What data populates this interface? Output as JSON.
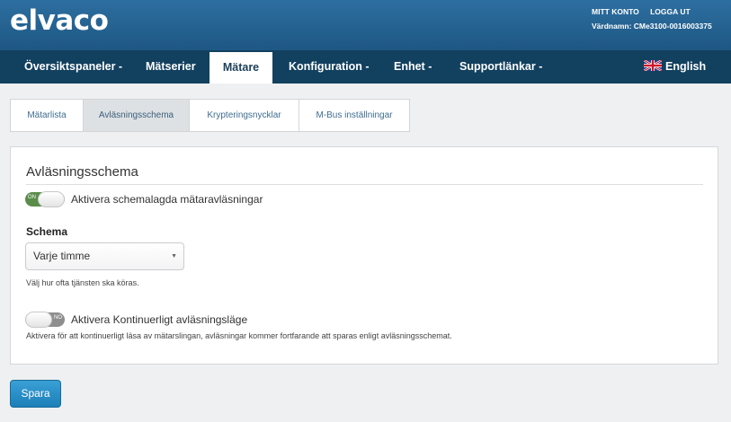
{
  "header": {
    "logo": "elvaco",
    "account_link": "MITT KONTO",
    "logout_link": "LOGGA UT",
    "hostname": "Värdnamn: CMe3100-0016003375"
  },
  "nav": {
    "items": [
      {
        "label": "Översiktspaneler -"
      },
      {
        "label": "Mätserier"
      },
      {
        "label": "Mätare"
      },
      {
        "label": "Konfiguration -"
      },
      {
        "label": "Enhet -"
      },
      {
        "label": "Supportlänkar -"
      }
    ],
    "language": "English"
  },
  "subtabs": [
    {
      "label": "Mätarlista"
    },
    {
      "label": "Avläsningsschema"
    },
    {
      "label": "Krypteringsnycklar"
    },
    {
      "label": "M-Bus inställningar"
    }
  ],
  "panel": {
    "title": "Avläsningsschema",
    "scheduled_toggle": {
      "label": "Aktivera schemalagda mätaravläsningar",
      "state_text": "ON"
    },
    "schedule_label": "Schema",
    "schedule_select": {
      "value": "Varje timme"
    },
    "schedule_help": "Välj hur ofta tjänsten ska köras.",
    "continuous_toggle": {
      "label": "Aktivera Kontinuerligt avläsningsläge",
      "state_text": "NO"
    },
    "continuous_help": "Aktivera för att kontinuerligt läsa av mätarslingan, avläsningar kommer fortfarande att sparas enligt avläsningsschemat."
  },
  "save_label": "Spara"
}
